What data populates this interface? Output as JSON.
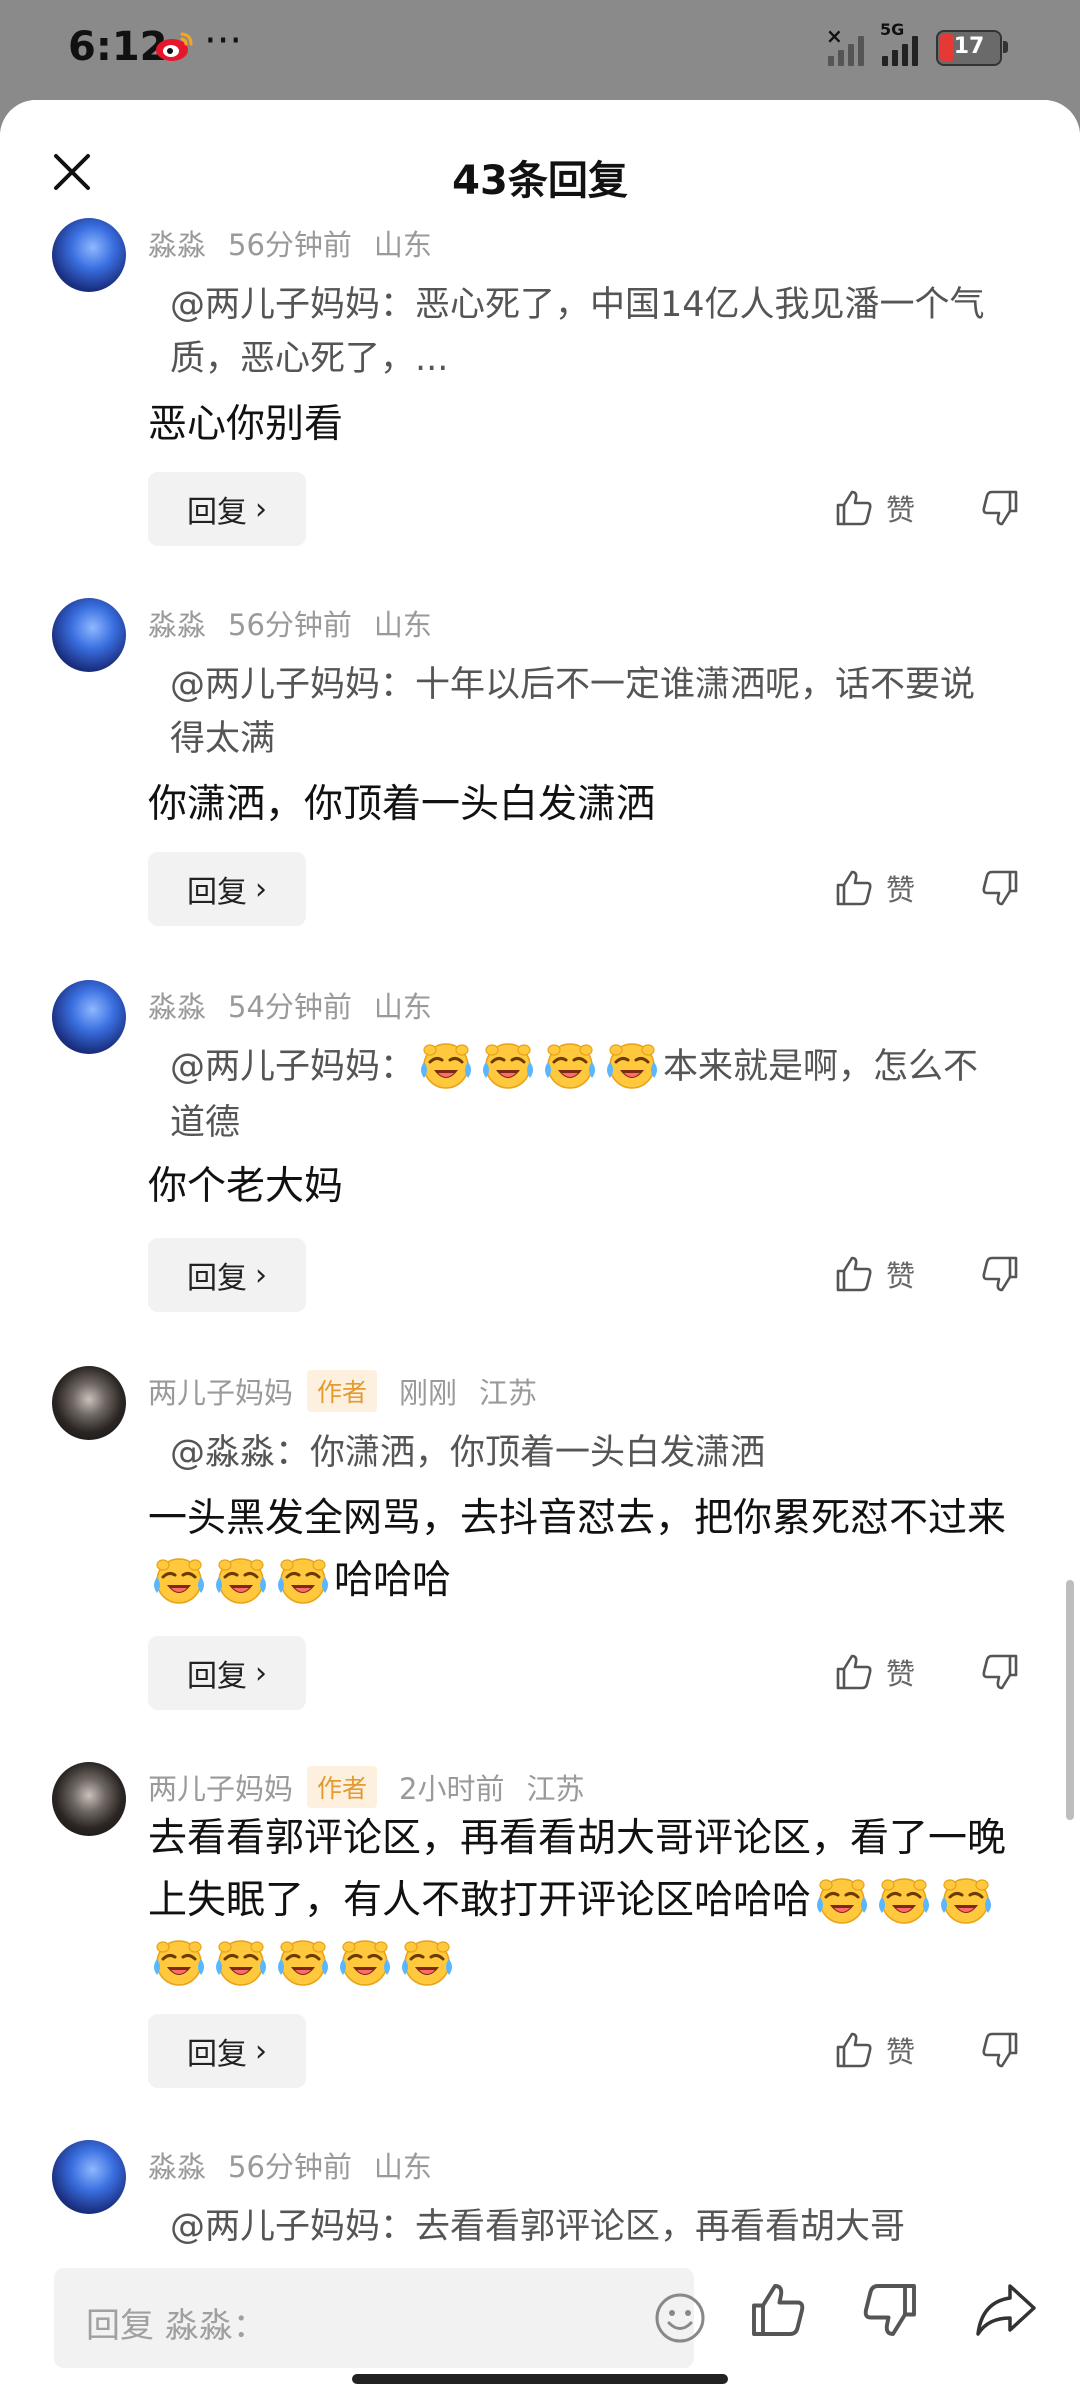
{
  "status": {
    "time": "6:12",
    "network": "5G",
    "battery": "17",
    "icons": [
      "weibo-icon",
      "more-dots-icon",
      "no-signal-icon",
      "5g-signal-icon",
      "battery-icon"
    ]
  },
  "header": {
    "title": "43条回复",
    "close_icon": "close-icon"
  },
  "comments": [
    {
      "user": "淼淼",
      "time": "56分钟前",
      "location": "山东",
      "author_tag": "",
      "quote": "@两儿子妈妈：恶心死了，中国14亿人我见潘一个气质，恶心死了，...",
      "text": "恶心你别看",
      "reply_label": "回复",
      "like_label": "赞"
    },
    {
      "user": "淼淼",
      "time": "56分钟前",
      "location": "山东",
      "author_tag": "",
      "quote": "@两儿子妈妈：十年以后不一定谁潇洒呢，话不要说得太满",
      "text": "你潇洒，你顶着一头白发潇洒",
      "reply_label": "回复",
      "like_label": "赞"
    },
    {
      "user": "淼淼",
      "time": "54分钟前",
      "location": "山东",
      "author_tag": "",
      "quote_prefix": "@两儿子妈妈：",
      "quote_suffix": "本来就是啊，怎么不道德",
      "text": "你个老大妈",
      "reply_label": "回复",
      "like_label": "赞"
    },
    {
      "user": "两儿子妈妈",
      "time": "刚刚",
      "location": "江苏",
      "author_tag": "作者",
      "quote": "@淼淼：你潇洒，你顶着一头白发潇洒",
      "text_prefix": "一头黑发全网骂，去抖音怼去，把你累死怼不过来",
      "text_suffix": "哈哈哈",
      "reply_label": "回复",
      "like_label": "赞"
    },
    {
      "user": "两儿子妈妈",
      "time": "2小时前",
      "location": "江苏",
      "author_tag": "作者",
      "text": "去看看郭评论区，再看看胡大哥评论区，看了一晚上失眠了，有人不敢打开评论区哈哈哈",
      "reply_label": "回复",
      "like_label": "赞"
    },
    {
      "user": "淼淼",
      "time": "56分钟前",
      "location": "山东",
      "author_tag": "",
      "quote": "@两儿子妈妈：去看看郭评论区，再看看胡大哥"
    }
  ],
  "emoji_name": "laughing-crying-emoji-icon",
  "bottom": {
    "input_placeholder": "回复 淼淼：",
    "icons": [
      "smile-icon",
      "like-icon",
      "dislike-icon",
      "share-icon"
    ]
  },
  "colors": {
    "author_tag_bg": "#fdf0de",
    "author_tag_fg": "#e39a2f",
    "meta_gray": "#9a9a9a",
    "battery_red": "#e53935"
  }
}
